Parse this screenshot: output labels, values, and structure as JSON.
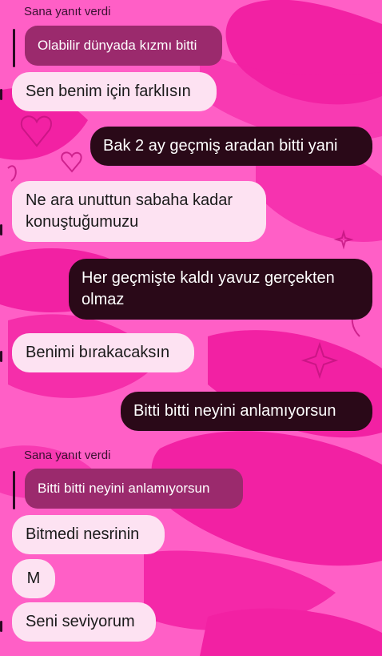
{
  "messages": [
    {
      "type": "reply-label",
      "text": "Sana yanıt verdi"
    },
    {
      "type": "reply-quote",
      "text": "Olabilir dünyada kızmı bitti"
    },
    {
      "type": "incoming",
      "text": "Sen benim için farklısın"
    },
    {
      "type": "outgoing",
      "text": "Bak 2 ay geçmiş aradan bitti yani"
    },
    {
      "type": "incoming",
      "text": "Ne ara unuttun sabaha kadar konuştuğumuzu"
    },
    {
      "type": "outgoing",
      "text": "Her geçmişte kaldı yavuz gerçekten olmaz"
    },
    {
      "type": "incoming",
      "text": "Benimi bırakacaksın"
    },
    {
      "type": "outgoing",
      "text": "Bitti bitti neyini anlamıyorsun"
    },
    {
      "type": "reply-label",
      "text": "Sana yanıt verdi"
    },
    {
      "type": "reply-quote",
      "text": "Bitti bitti neyini anlamıyorsun"
    },
    {
      "type": "incoming",
      "text": "Bitmedi nesrinin"
    },
    {
      "type": "incoming",
      "text": "M"
    },
    {
      "type": "incoming",
      "text": "Seni seviyorum"
    }
  ],
  "colors": {
    "background": "#ff5fc6",
    "lips": "#f0179e",
    "incoming_bubble": "#fde2f2",
    "outgoing_bubble": "#2a0918",
    "reply_quote": "#9b2a6d"
  }
}
